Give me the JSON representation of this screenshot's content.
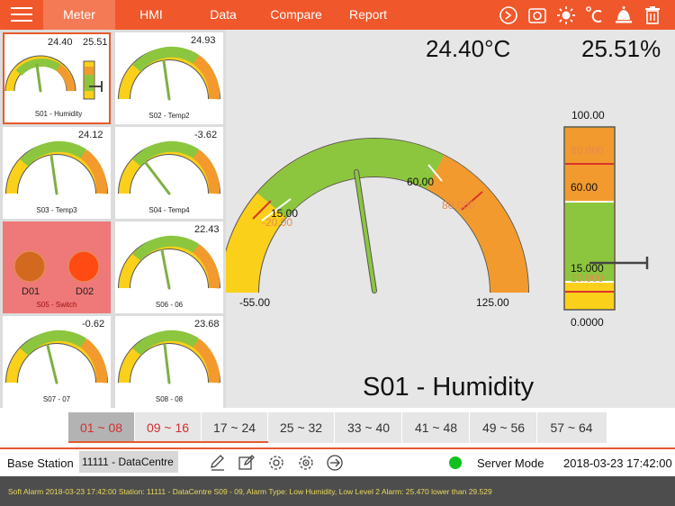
{
  "topbar": {
    "tabs": [
      {
        "label": "Meter",
        "active": true
      },
      {
        "label": "HMI",
        "active": false
      },
      {
        "label": "Data",
        "active": false
      },
      {
        "label": "Compare",
        "active": false
      },
      {
        "label": "Report",
        "active": false
      }
    ],
    "icons": [
      "history-dial-icon",
      "camera-icon",
      "brightness-icon",
      "celsius-icon",
      "alarm-bell-icon",
      "delete-icon"
    ],
    "accent_color": "#f0572b"
  },
  "sensors": [
    {
      "label": "S01 - Humidity",
      "value": "24.40",
      "value2": "25.51",
      "selected": true
    },
    {
      "label": "S02 - Temp2",
      "value": "24.93"
    },
    {
      "label": "S03 - Temp3",
      "value": "24.12"
    },
    {
      "label": "S04 - Temp4",
      "value": "-3.62"
    },
    {
      "label": "S05 - Switch",
      "switch1": "D01",
      "switch2": "D02"
    },
    {
      "label": "S06 - 06",
      "value": "22.43"
    },
    {
      "label": "S07 - 07",
      "value": "-0.62"
    },
    {
      "label": "S08 - 08",
      "value": "23.68"
    }
  ],
  "main": {
    "temp": "24.40°C",
    "humidity": "25.51%",
    "title": "S01 - Humidity",
    "gauge": {
      "min": "-55.00",
      "max": "125.00",
      "low": "15.00",
      "high": "60.00",
      "low_alarm": "-20.00",
      "high_alarm": "80.000"
    },
    "bar": {
      "max": "100.00",
      "high_alarm": "80.000",
      "high": "60.00",
      "low": "15.000",
      "low_alarm": "10.000",
      "min": "0.0000"
    }
  },
  "pages": [
    "01 ~ 08",
    "09 ~ 16",
    "17 ~ 24",
    "25 ~ 32",
    "33 ~ 40",
    "41 ~ 48",
    "49 ~ 56",
    "57 ~ 64"
  ],
  "status": {
    "station_label": "Base Station",
    "station_value": "11111 - DataCentre",
    "server_mode": "Server Mode",
    "time": "2018-03-23 17:42:00",
    "online_color": "#11c01f"
  },
  "alarm": {
    "text": "Soft Alarm 2018-03-23 17:42:00 Station: 11111 - DataCentre S09 - 09, Alarm Type: Low Humidity, Low Level 2 Alarm: 25.470 lower than 29.529"
  }
}
